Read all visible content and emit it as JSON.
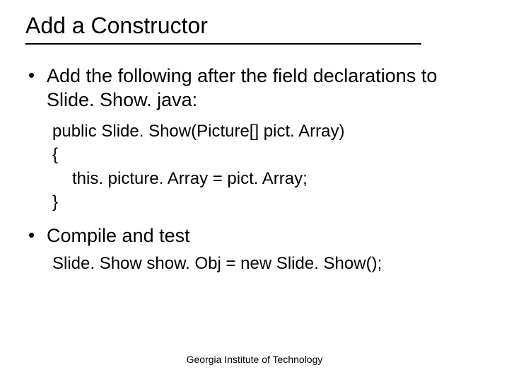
{
  "title": "Add a Constructor",
  "bullets": [
    {
      "text": "Add the following after the field declarations to Slide. Show. java:",
      "code": [
        "public Slide. Show(Picture[] pict. Array)",
        "{",
        "this. picture. Array = pict. Array;",
        "}"
      ]
    },
    {
      "text": "Compile and test",
      "example": "Slide. Show show. Obj = new Slide. Show();"
    }
  ],
  "footer": "Georgia Institute of Technology"
}
